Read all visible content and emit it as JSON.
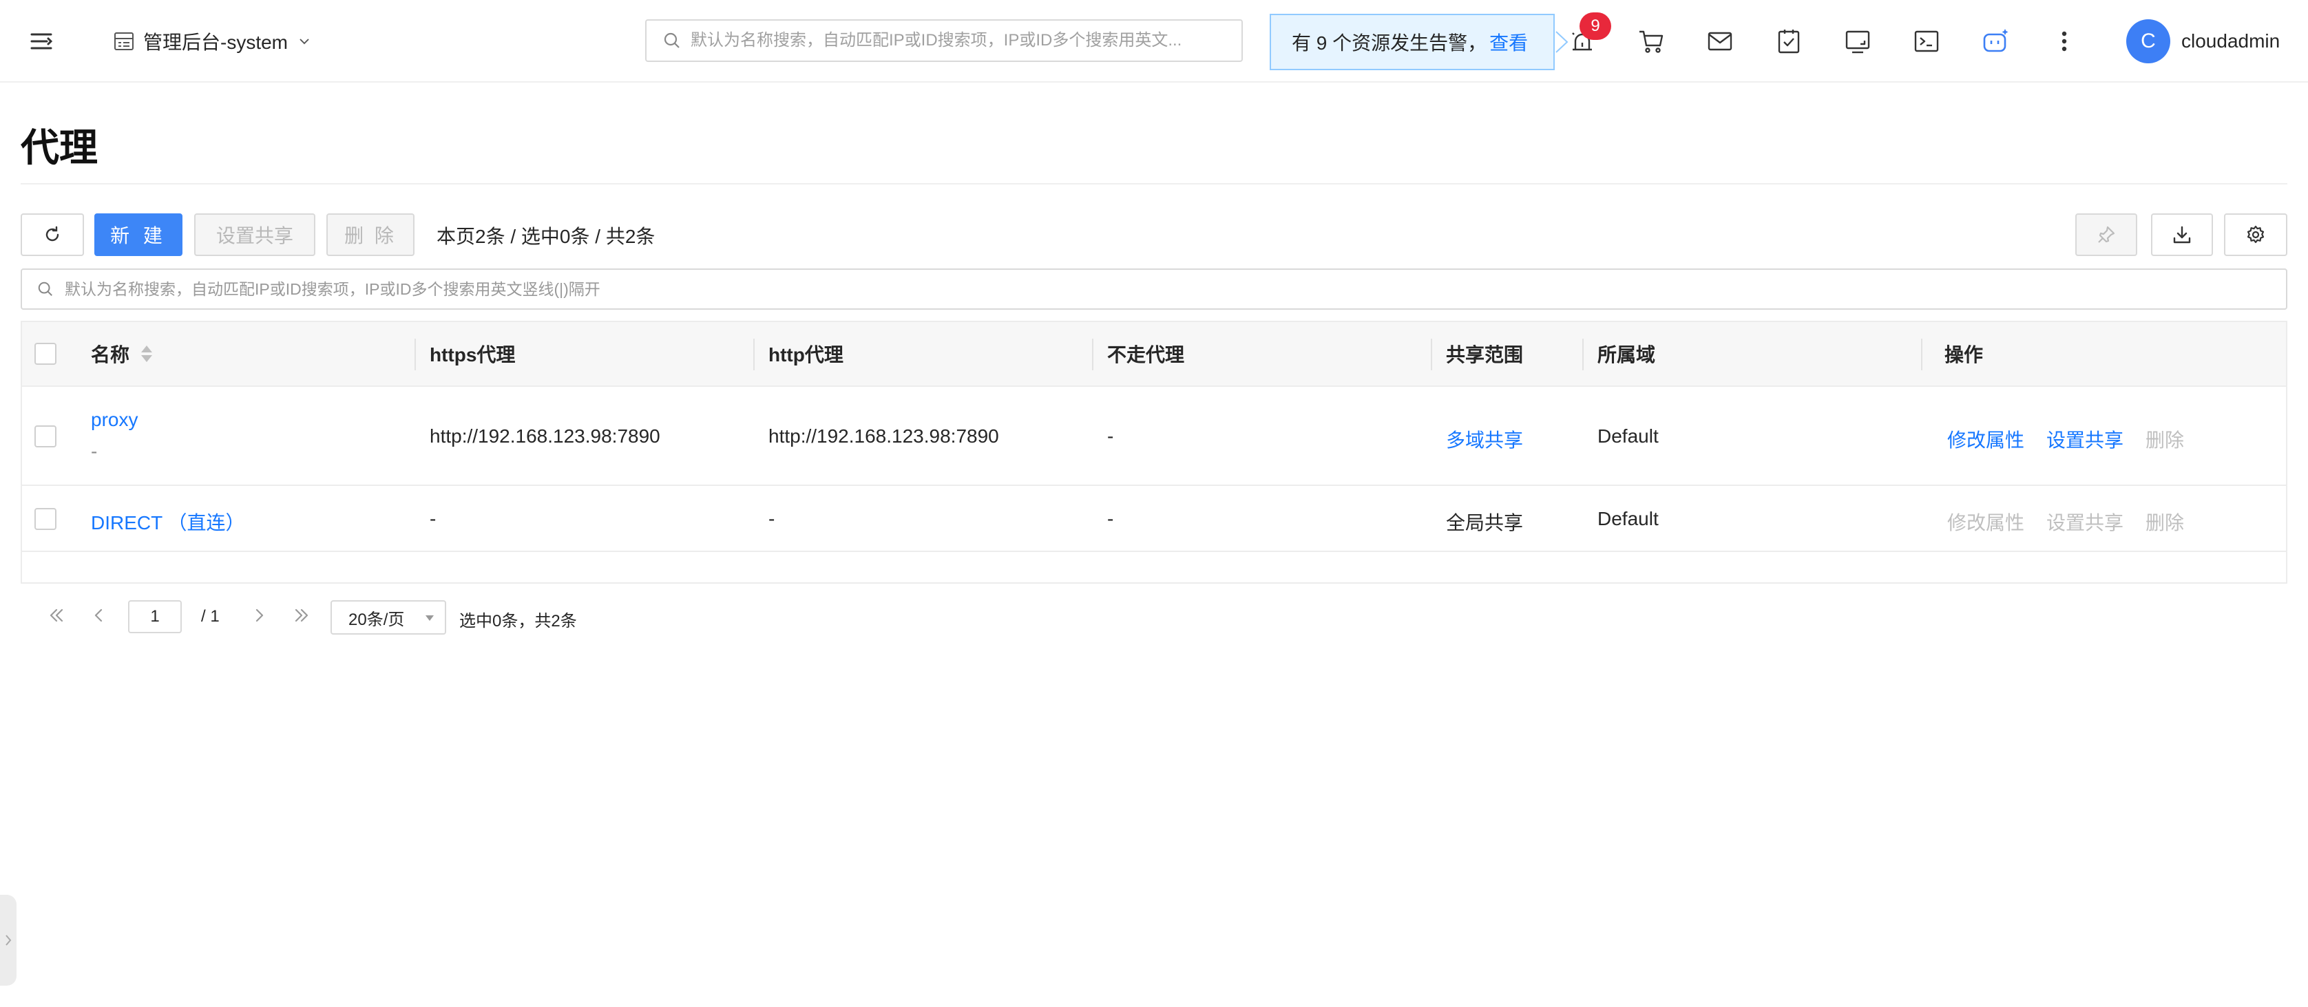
{
  "header": {
    "project_label": "管理后台-system",
    "search_placeholder": "默认为名称搜索，自动匹配IP或ID搜索项，IP或ID多个搜索用英文...",
    "alert_text": "有 9 个资源发生告警，",
    "alert_link": "查看",
    "alarm_count": "9",
    "icons": [
      "alarm-icon",
      "cart-icon",
      "mail-icon",
      "task-icon",
      "monitor-icon",
      "terminal-icon",
      "ai-assistant-icon",
      "more-icon"
    ],
    "user": {
      "avatar_letter": "C",
      "name": "cloudadmin"
    }
  },
  "page": {
    "title": "代理"
  },
  "toolbar": {
    "new_label": "新 建",
    "share_label": "设置共享",
    "delete_label": "删 除",
    "count_text": "本页2条 / 选中0条 / 共2条"
  },
  "search": {
    "placeholder": "默认为名称搜索，自动匹配IP或ID搜索项，IP或ID多个搜索用英文竖线(|)隔开"
  },
  "table": {
    "columns": [
      "名称",
      "https代理",
      "http代理",
      "不走代理",
      "共享范围",
      "所属域",
      "操作"
    ],
    "rows": [
      {
        "name": "proxy",
        "desc": "-",
        "https": "http://192.168.123.98:7890",
        "http": "http://192.168.123.98:7890",
        "no_proxy": "-",
        "share": "多域共享",
        "domain": "Default",
        "actions": [
          "修改属性",
          "设置共享",
          "删除"
        ]
      },
      {
        "name": "DIRECT （直连）",
        "https": "-",
        "http": "-",
        "no_proxy": "-",
        "share": "全局共享",
        "domain": "Default",
        "actions": [
          "修改属性",
          "设置共享",
          "删除"
        ]
      }
    ]
  },
  "pagination": {
    "current": "1",
    "total_pages": "/ 1",
    "page_size": "20条/页",
    "summary": "选中0条，共2条"
  },
  "colors": {
    "primary": "#3d86f7",
    "link": "#1677ff",
    "alert_bg": "#e6f4ff",
    "badge": "#e8283b"
  }
}
